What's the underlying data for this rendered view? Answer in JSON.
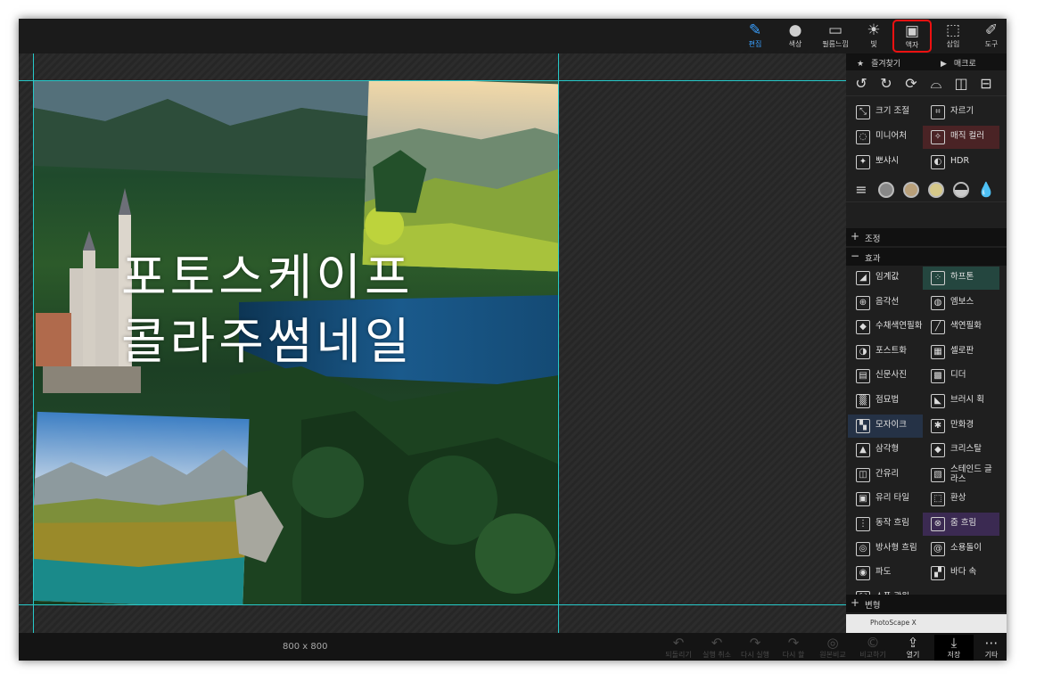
{
  "toolbar": {
    "items": [
      {
        "label": "편집",
        "icon": "edit-icon",
        "glyph": "✎"
      },
      {
        "label": "색상",
        "icon": "color-icon",
        "glyph": "●"
      },
      {
        "label": "필름느낌",
        "icon": "film-icon",
        "glyph": "▭"
      },
      {
        "label": "빛",
        "icon": "light-icon",
        "glyph": "☀"
      },
      {
        "label": "액자",
        "icon": "frame-icon",
        "glyph": "▣"
      },
      {
        "label": "삽입",
        "icon": "insert-icon",
        "glyph": "⬚"
      },
      {
        "label": "도구",
        "icon": "tools-icon",
        "glyph": "✐"
      }
    ],
    "active": "편집",
    "highlighted": "액자"
  },
  "canvas": {
    "title_line1": "포토스케이프",
    "title_line2": "콜라주썸네일",
    "size_label": "800 x 800"
  },
  "bottom": {
    "items": [
      {
        "label": "되돌리기",
        "glyph": "↶"
      },
      {
        "label": "실행 취소",
        "glyph": "↶"
      },
      {
        "label": "다시 실행",
        "glyph": "↷"
      },
      {
        "label": "다시 할",
        "glyph": "↷"
      },
      {
        "label": "원본비교",
        "glyph": "◎"
      },
      {
        "label": "비교하기",
        "glyph": "©"
      },
      {
        "label": "열기",
        "glyph": "⇪"
      },
      {
        "label": "저장",
        "glyph": "⤓"
      },
      {
        "label": "기타",
        "glyph": "⋯"
      }
    ]
  },
  "panel": {
    "tabs": {
      "favorites": "즐겨찾기",
      "macro": "매크로"
    },
    "rotate_icons": [
      "rotate-left-icon",
      "rotate-right-icon",
      "rotate-free-icon",
      "straighten-icon",
      "flip-horizontal-icon",
      "flip-vertical-icon"
    ],
    "edit_items": [
      {
        "label": "크기 조절",
        "glyph": "⤡",
        "hl": ""
      },
      {
        "label": "자르기",
        "glyph": "⌗",
        "hl": ""
      },
      {
        "label": "미니어처",
        "glyph": "◌",
        "hl": ""
      },
      {
        "label": "매직 컬러",
        "glyph": "✧",
        "hl": "red"
      },
      {
        "label": "뽀샤시",
        "glyph": "✦",
        "hl": ""
      },
      {
        "label": "HDR",
        "glyph": "◐",
        "hl": ""
      }
    ],
    "filter_icons": [
      "levels-icon",
      "tone-gray-icon",
      "tone-sepia-icon",
      "tone-warm-icon",
      "tone-dark-icon",
      "drop-icon"
    ],
    "sections": {
      "adjust": "조정",
      "effects": "효과",
      "transform": "변형"
    },
    "effects": [
      {
        "label": "임계값",
        "glyph": "◢",
        "hl": ""
      },
      {
        "label": "하프톤",
        "glyph": "⁘",
        "hl": "green"
      },
      {
        "label": "음각선",
        "glyph": "⊕",
        "hl": ""
      },
      {
        "label": "엠보스",
        "glyph": "◍",
        "hl": ""
      },
      {
        "label": "수채색연필화",
        "glyph": "◆",
        "hl": ""
      },
      {
        "label": "색연필화",
        "glyph": "╱",
        "hl": ""
      },
      {
        "label": "포스트화",
        "glyph": "◑",
        "hl": ""
      },
      {
        "label": "셀로판",
        "glyph": "▦",
        "hl": ""
      },
      {
        "label": "신문사진",
        "glyph": "▤",
        "hl": ""
      },
      {
        "label": "디더",
        "glyph": "▩",
        "hl": ""
      },
      {
        "label": "점묘법",
        "glyph": "▒",
        "hl": ""
      },
      {
        "label": "브러시 획",
        "glyph": "◣",
        "hl": ""
      },
      {
        "label": "모자이크",
        "glyph": "▚",
        "hl": "blue"
      },
      {
        "label": "만화경",
        "glyph": "✱",
        "hl": ""
      },
      {
        "label": "삼각형",
        "glyph": "▲",
        "hl": ""
      },
      {
        "label": "크리스탈",
        "glyph": "◆",
        "hl": ""
      },
      {
        "label": "간유리",
        "glyph": "◫",
        "hl": ""
      },
      {
        "label": "스테인드 글라스",
        "glyph": "▧",
        "hl": ""
      },
      {
        "label": "유리 타일",
        "glyph": "▣",
        "hl": ""
      },
      {
        "label": "환상",
        "glyph": "⬚",
        "hl": ""
      },
      {
        "label": "동작 흐림",
        "glyph": "⋮",
        "hl": ""
      },
      {
        "label": "줌 흐림",
        "glyph": "⊗",
        "hl": "purple"
      },
      {
        "label": "방사형 흐림",
        "glyph": "◎",
        "hl": ""
      },
      {
        "label": "소용돌이",
        "glyph": "@",
        "hl": ""
      },
      {
        "label": "파도",
        "glyph": "◉",
        "hl": ""
      },
      {
        "label": "바다 속",
        "glyph": "▞",
        "hl": ""
      },
      {
        "label": "스폿 광원",
        "glyph": "⛶",
        "hl": ""
      }
    ],
    "thumb_label": "PhotoScape X"
  }
}
